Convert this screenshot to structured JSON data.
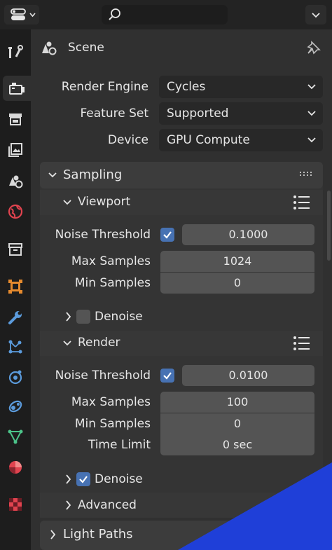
{
  "header": {
    "context_title": "Scene",
    "icons": [
      "editor-type-icon",
      "search-icon",
      "chevron-down-icon",
      "pin-icon"
    ]
  },
  "tabs": [
    "tool-icon",
    "render-icon",
    "output-icon",
    "view-layer-icon",
    "scene-icon",
    "world-icon",
    "collection-icon",
    "object-icon",
    "modifier-icon",
    "particles-icon",
    "physics-icon",
    "constraints-icon",
    "data-icon",
    "material-icon",
    "texture-icon"
  ],
  "render": {
    "render_engine_label": "Render Engine",
    "render_engine_value": "Cycles",
    "feature_set_label": "Feature Set",
    "feature_set_value": "Supported",
    "device_label": "Device",
    "device_value": "GPU Compute"
  },
  "sampling": {
    "title": "Sampling",
    "viewport": {
      "title": "Viewport",
      "noise_threshold_label": "Noise Threshold",
      "noise_threshold_value": "0.1000",
      "noise_threshold_enabled": true,
      "max_samples_label": "Max Samples",
      "max_samples_value": "1024",
      "min_samples_label": "Min Samples",
      "min_samples_value": "0",
      "denoise_label": "Denoise",
      "denoise_enabled": false
    },
    "render": {
      "title": "Render",
      "noise_threshold_label": "Noise Threshold",
      "noise_threshold_value": "0.0100",
      "noise_threshold_enabled": true,
      "max_samples_label": "Max Samples",
      "max_samples_value": "100",
      "min_samples_label": "Min Samples",
      "min_samples_value": "0",
      "time_limit_label": "Time Limit",
      "time_limit_value": "0 sec",
      "denoise_label": "Denoise",
      "denoise_enabled": true
    },
    "advanced_title": "Advanced"
  },
  "light_paths": {
    "title": "Light Paths"
  },
  "colors": {
    "accent": "#4772b3",
    "corner_overlay": "#1f3fd8"
  }
}
